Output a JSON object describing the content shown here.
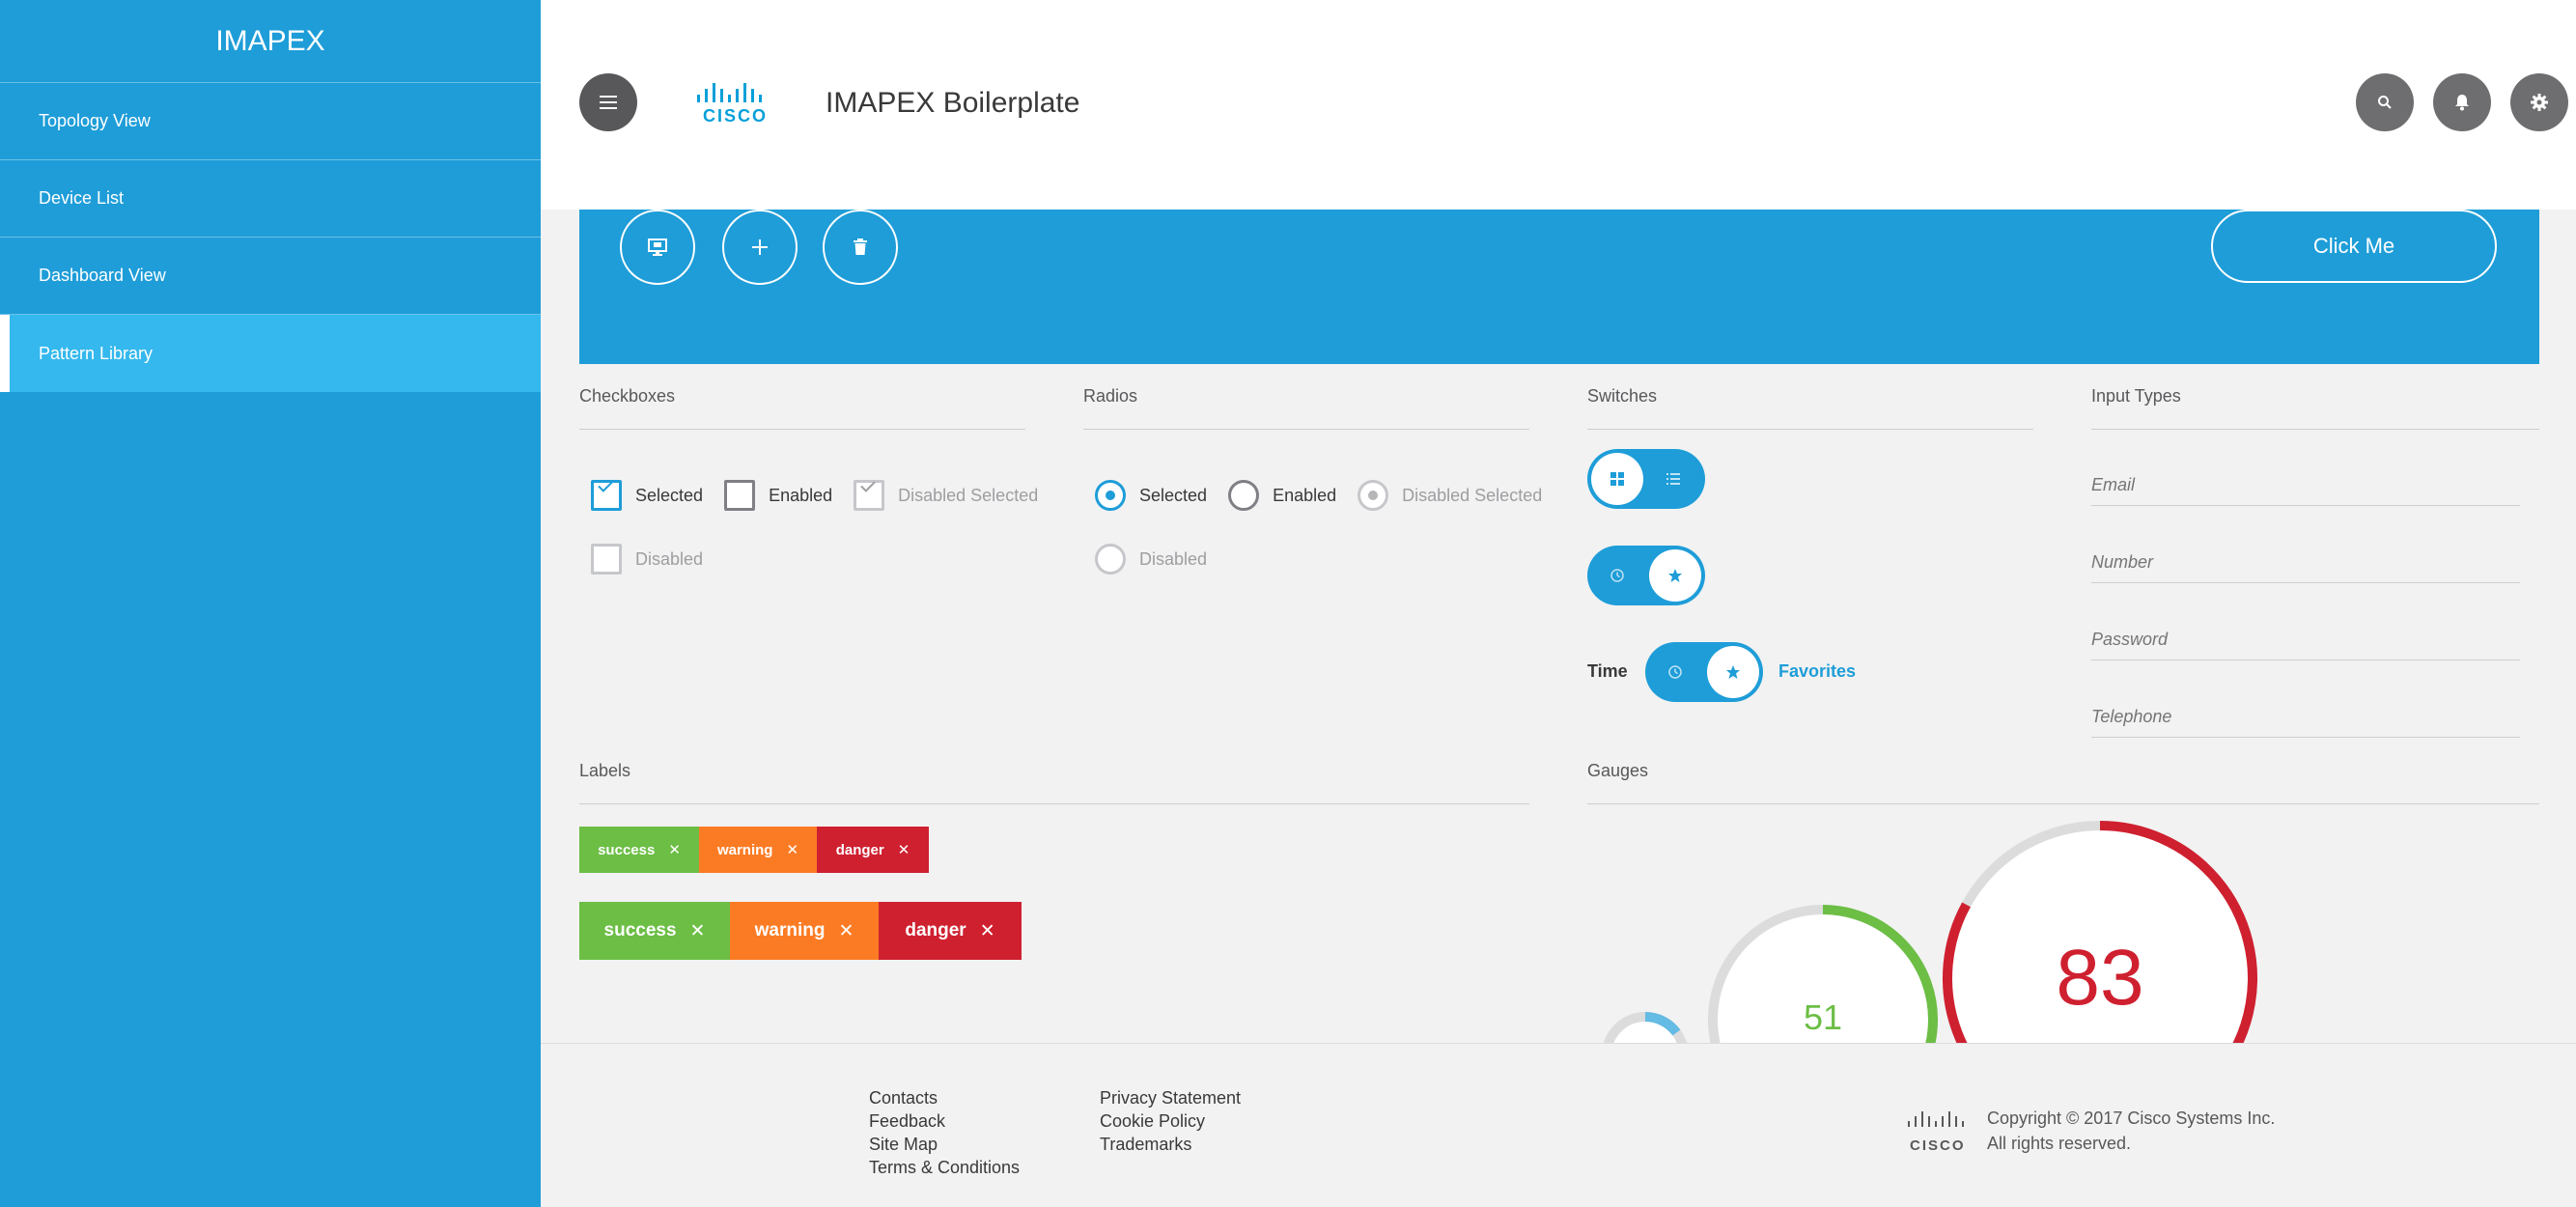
{
  "sidebar": {
    "brand": "IMAPEX",
    "items": [
      {
        "label": "Topology View"
      },
      {
        "label": "Device List"
      },
      {
        "label": "Dashboard View"
      },
      {
        "label": "Pattern Library"
      }
    ]
  },
  "header": {
    "title": "IMAPEX Boilerplate",
    "logo_text": "CISCO"
  },
  "banner": {
    "click_me_label": "Click Me"
  },
  "checkboxes": {
    "title": "Checkboxes",
    "selected": "Selected",
    "enabled": "Enabled",
    "disabled_selected": "Disabled Selected",
    "disabled": "Disabled"
  },
  "radios": {
    "title": "Radios",
    "selected": "Selected",
    "enabled": "Enabled",
    "disabled_selected": "Disabled Selected",
    "disabled": "Disabled"
  },
  "switches": {
    "title": "Switches",
    "left_label": "Time",
    "right_label": "Favorites"
  },
  "input_types": {
    "title": "Input Types",
    "email": "Email",
    "number": "Number",
    "password": "Password",
    "telephone": "Telephone"
  },
  "labels": {
    "title": "Labels",
    "success": "success",
    "warning": "warning",
    "danger": "danger"
  },
  "gauges": {
    "title": "Gauges",
    "small_value": 51,
    "large_value": 83,
    "small_text": "51",
    "large_text": "83"
  },
  "footer": {
    "col1": [
      "Contacts",
      "Feedback",
      "Site Map",
      "Terms & Conditions"
    ],
    "col2": [
      "Privacy Statement",
      "Cookie Policy",
      "Trademarks"
    ],
    "logo_text": "CISCO",
    "copyright_line1": "Copyright © 2017 Cisco Systems Inc.",
    "copyright_line2": "All rights reserved."
  },
  "colors": {
    "primary": "#1e9dd8",
    "success": "#6cbe45",
    "warning": "#fb7b24",
    "danger": "#cf2030"
  }
}
